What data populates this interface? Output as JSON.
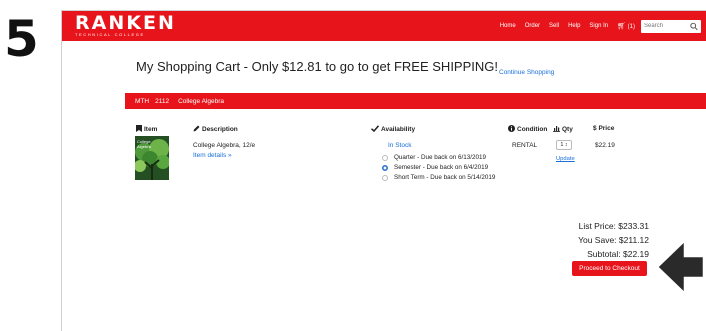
{
  "step_number": "5",
  "header": {
    "logo": "RANKEN",
    "logo_subtitle": "TECHNICAL COLLEGE",
    "nav": [
      "Home",
      "Order",
      "Sell",
      "Help",
      "Sign In"
    ],
    "cart_count": "(1)",
    "search_placeholder": "Search"
  },
  "page": {
    "title": "My Shopping Cart - Only $12.81 to go to get FREE SHIPPING!",
    "continue_link": "Continue Shopping"
  },
  "course": {
    "code": "MTH",
    "number": "2112",
    "name": "College Algebra"
  },
  "columns": {
    "item": "Item",
    "description": "Description",
    "availability": "Availability",
    "condition": "Condition",
    "qty": "Qty",
    "price": "Price"
  },
  "item": {
    "cover_text": "College Algebra",
    "description": "College Algebra, 12/e",
    "details_link": "Item details »",
    "stock_status": "In Stock",
    "rental_options": [
      {
        "label": "Quarter - Due back on 6/13/2019",
        "selected": false
      },
      {
        "label": "Semester - Due back on 6/4/2019",
        "selected": true
      },
      {
        "label": "Short Term - Due back on 5/14/2019",
        "selected": false
      }
    ],
    "condition": "RENTAL",
    "qty": "1",
    "update_link": "Update",
    "price": "$22.19"
  },
  "summary": {
    "list_price": "List Price: $233.31",
    "you_save": "You Save: $211.12",
    "subtotal": "Subtotal: $22.19",
    "checkout_button": "Proceed to Checkout"
  },
  "colors": {
    "brand_red": "#e8141b",
    "link_blue": "#1a6fd8"
  },
  "icons": [
    "search-icon",
    "cart-icon",
    "bookmark-icon",
    "pencil-icon",
    "checkmark-icon",
    "info-icon",
    "bar-chart-icon",
    "dollar-icon",
    "arrow-pointer-icon"
  ]
}
